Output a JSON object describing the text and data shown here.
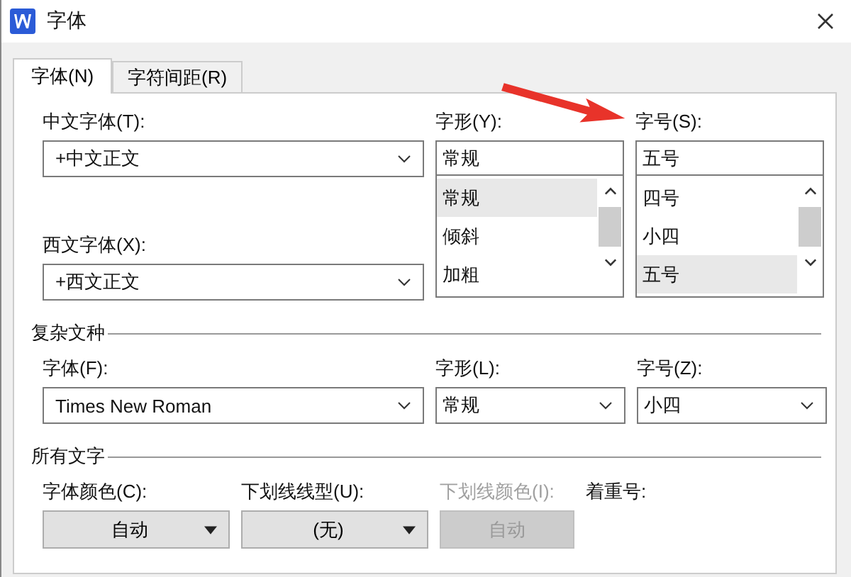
{
  "window": {
    "title": "字体"
  },
  "tabs": [
    {
      "label": "字体(N)",
      "selected": true
    },
    {
      "label": "字符间距(R)",
      "selected": false
    }
  ],
  "chinese_font": {
    "label": "中文字体(T):",
    "value": "+中文正文"
  },
  "western_font": {
    "label": "西文字体(X):",
    "value": "+西文正文"
  },
  "style": {
    "label": "字形(Y):",
    "value": "常规",
    "options": [
      {
        "label": "常规",
        "selected": true
      },
      {
        "label": "倾斜",
        "selected": false
      },
      {
        "label": "加粗",
        "selected": false
      }
    ]
  },
  "size": {
    "label": "字号(S):",
    "value": "五号",
    "options": [
      {
        "label": "四号",
        "selected": false
      },
      {
        "label": "小四",
        "selected": false
      },
      {
        "label": "五号",
        "selected": true
      }
    ]
  },
  "complex_script": {
    "title": "复杂文种",
    "font": {
      "label": "字体(F):",
      "value": "Times New Roman"
    },
    "style": {
      "label": "字形(L):",
      "value": "常规"
    },
    "size": {
      "label": "字号(Z):",
      "value": "小四"
    }
  },
  "all_text": {
    "title": "所有文字",
    "controls": [
      {
        "label": "字体颜色(C):",
        "value": "自动",
        "disabled": false
      },
      {
        "label": "下划线线型(U):",
        "value": "(无)",
        "disabled": false
      },
      {
        "label": "下划线颜色(I):",
        "value": "自动",
        "disabled": true
      }
    ],
    "emphasis": {
      "label": "着重号:"
    }
  }
}
